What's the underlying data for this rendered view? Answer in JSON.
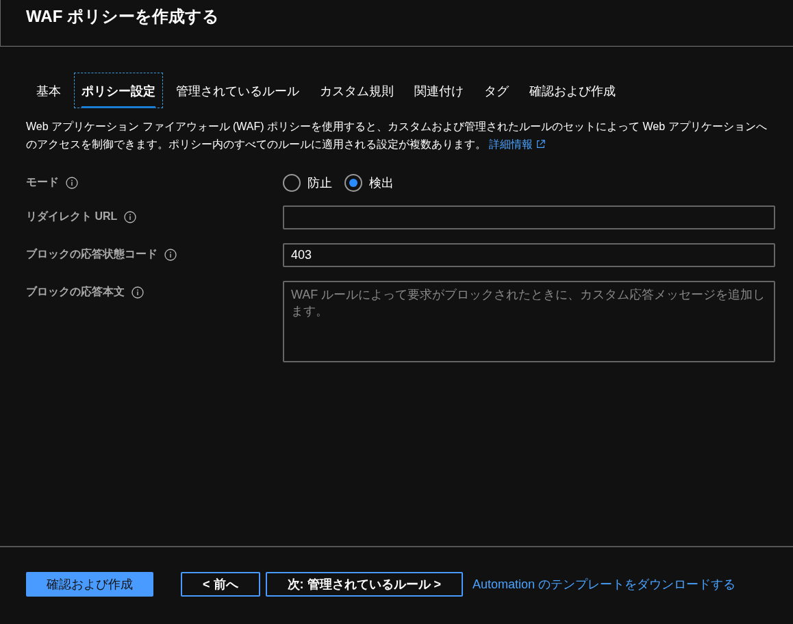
{
  "window": {
    "title": "WAF ポリシーを作成する"
  },
  "tabs": [
    {
      "label": "基本",
      "selected": false
    },
    {
      "label": "ポリシー設定",
      "selected": true
    },
    {
      "label": "管理されているルール",
      "selected": false
    },
    {
      "label": "カスタム規則",
      "selected": false
    },
    {
      "label": "関連付け",
      "selected": false
    },
    {
      "label": "タグ",
      "selected": false
    },
    {
      "label": "確認および作成",
      "selected": false
    }
  ],
  "description": {
    "text": "Web アプリケーション ファイアウォール (WAF) ポリシーを使用すると、カスタムおよび管理されたルールのセットによって Web アプリケーションへのアクセスを制御できます。ポリシー内のすべてのルールに適用される設定が複数あります。",
    "link": "詳細情報"
  },
  "fields": [
    {
      "kind": "radio",
      "label": "モード",
      "options": [
        {
          "label": "防止",
          "selected": false
        },
        {
          "label": "検出",
          "selected": true
        }
      ]
    },
    {
      "kind": "text",
      "label": "リダイレクト URL"
    },
    {
      "kind": "text",
      "label": "ブロックの応答状態コード",
      "value": "403"
    },
    {
      "kind": "textarea",
      "label": "ブロックの応答本文",
      "placeholder": "WAF ルールによって要求がブロックされたときに、カスタム応答メッセージを追加します。"
    }
  ],
  "footer": {
    "buttons": [
      {
        "label": "確認および作成",
        "kind": "primary"
      },
      {
        "label": "< 前へ",
        "kind": "secondary"
      },
      {
        "label": "次: 管理されているルール >",
        "kind": "secondary"
      }
    ],
    "link": "Automation のテンプレートをダウンロードする"
  }
}
